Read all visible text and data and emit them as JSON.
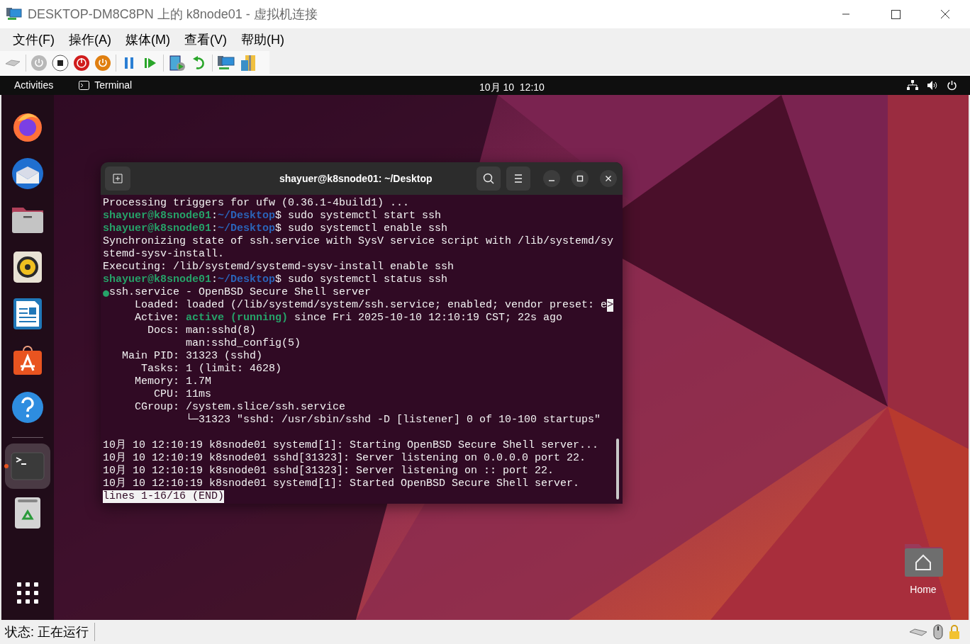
{
  "window": {
    "title": "DESKTOP-DM8C8PN 上的 k8node01 - 虚拟机连接"
  },
  "menu": [
    "文件(F)",
    "操作(A)",
    "媒体(M)",
    "查看(V)",
    "帮助(H)"
  ],
  "top_bar": {
    "activities": "Activities",
    "app": "Terminal",
    "clock": "10月 10  12:10"
  },
  "dock": [
    {
      "kind": "firefox",
      "selected": false
    },
    {
      "kind": "thunderbird",
      "selected": false
    },
    {
      "kind": "files",
      "selected": false
    },
    {
      "kind": "rhythmbox",
      "selected": false
    },
    {
      "kind": "writer",
      "selected": false
    },
    {
      "kind": "software",
      "selected": false
    },
    {
      "kind": "help",
      "selected": false
    },
    {
      "kind": "separator"
    },
    {
      "kind": "terminal",
      "selected": true
    },
    {
      "kind": "trash",
      "selected": false
    }
  ],
  "terminal": {
    "title": "shayuer@k8snode01: ~/Desktop",
    "lines": [
      [
        {
          "text": "Processing triggers for ufw (0.36.1-4build1) ...",
          "kind": "plain"
        }
      ],
      [
        {
          "text": "shayuer@k8snode01",
          "kind": "user"
        },
        {
          "text": ":",
          "kind": "plain"
        },
        {
          "text": "~/Desktop",
          "kind": "path"
        },
        {
          "text": "$ sudo systemctl start ssh",
          "kind": "plain"
        }
      ],
      [
        {
          "text": "shayuer@k8snode01",
          "kind": "user"
        },
        {
          "text": ":",
          "kind": "plain"
        },
        {
          "text": "~/Desktop",
          "kind": "path"
        },
        {
          "text": "$ sudo systemctl enable ssh",
          "kind": "plain"
        }
      ],
      [
        {
          "text": "Synchronizing state of ssh.service with SysV service script with /lib/systemd/sy",
          "kind": "plain"
        }
      ],
      [
        {
          "text": "stemd-sysv-install.",
          "kind": "plain"
        }
      ],
      [
        {
          "text": "Executing: /lib/systemd/systemd-sysv-install enable ssh",
          "kind": "plain"
        }
      ],
      [
        {
          "text": "shayuer@k8snode01",
          "kind": "user"
        },
        {
          "text": ":",
          "kind": "plain"
        },
        {
          "text": "~/Desktop",
          "kind": "path"
        },
        {
          "text": "$ sudo systemctl status ssh",
          "kind": "plain"
        }
      ],
      [
        {
          "text": "●",
          "kind": "bullet"
        },
        {
          "text": "ssh.service - OpenBSD Secure Shell server",
          "kind": "plain"
        }
      ],
      [
        {
          "text": "     Loaded: loaded (/lib/systemd/system/ssh.service; enabled; vendor preset: e",
          "kind": "plain"
        },
        {
          "text": ">",
          "kind": "inverse"
        }
      ],
      [
        {
          "text": "     Active: ",
          "kind": "plain"
        },
        {
          "text": "active (running)",
          "kind": "active"
        },
        {
          "text": " since Fri 2025-10-10 12:10:19 CST; 22s ago",
          "kind": "plain"
        }
      ],
      [
        {
          "text": "       Docs: man:sshd(8)",
          "kind": "plain"
        }
      ],
      [
        {
          "text": "             man:sshd_config(5)",
          "kind": "plain"
        }
      ],
      [
        {
          "text": "   Main PID: 31323 (sshd)",
          "kind": "plain"
        }
      ],
      [
        {
          "text": "      Tasks: 1 (limit: 4628)",
          "kind": "plain"
        }
      ],
      [
        {
          "text": "     Memory: 1.7M",
          "kind": "plain"
        }
      ],
      [
        {
          "text": "        CPU: 11ms",
          "kind": "plain"
        }
      ],
      [
        {
          "text": "     CGroup: /system.slice/ssh.service",
          "kind": "plain"
        }
      ],
      [
        {
          "text": "             └─31323 \"sshd: /usr/sbin/sshd -D [listener] 0 of 10-100 startups\"",
          "kind": "plain"
        }
      ],
      [
        {
          "text": "10月 10 12:10:19 k8snode01 systemd[1]: Starting OpenBSD Secure Shell server...",
          "kind": "blank_before"
        }
      ],
      [
        {
          "text": "10月 10 12:10:19 k8snode01 sshd[31323]: Server listening on 0.0.0.0 port 22.",
          "kind": "plain"
        }
      ],
      [
        {
          "text": "10月 10 12:10:19 k8snode01 sshd[31323]: Server listening on :: port 22.",
          "kind": "plain"
        }
      ],
      [
        {
          "text": "10月 10 12:10:19 k8snode01 systemd[1]: Started OpenBSD Secure Shell server.",
          "kind": "plain"
        }
      ],
      [
        {
          "text": "lines 1-16/16 (END)",
          "kind": "inverse"
        }
      ]
    ]
  },
  "desktop_icons": [
    {
      "label": "Home"
    }
  ],
  "status_bar": {
    "text": "状态: 正在运行"
  }
}
